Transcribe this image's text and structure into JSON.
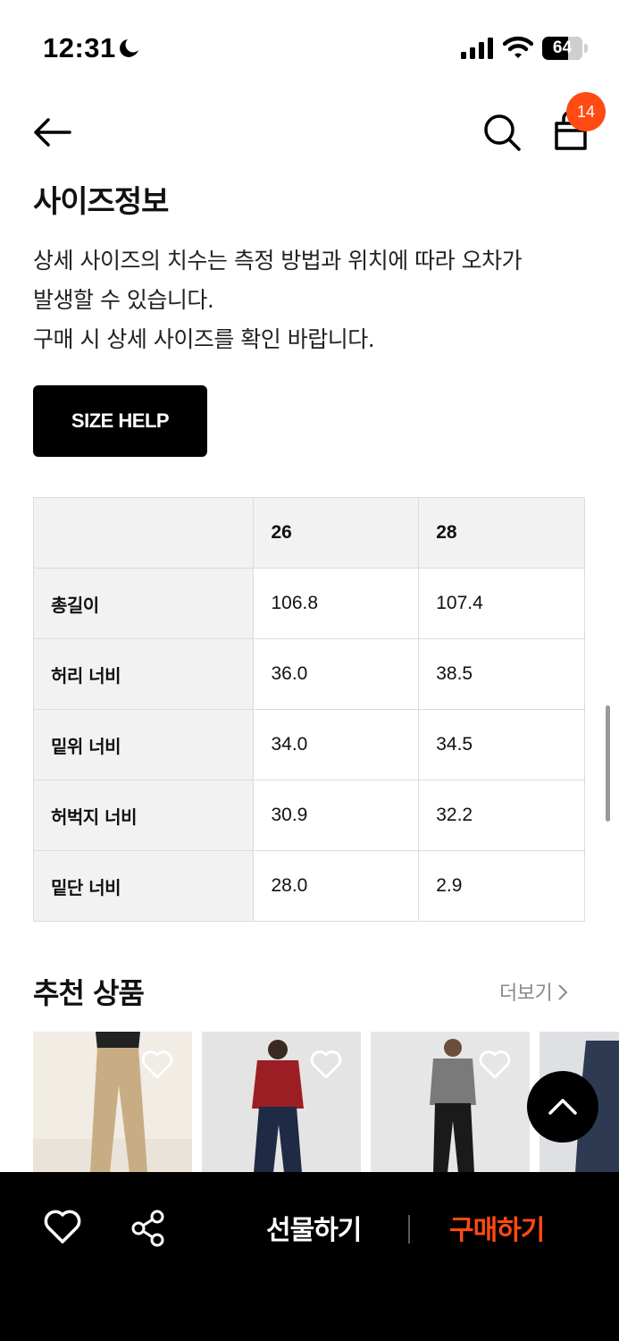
{
  "status_bar": {
    "time": "12:31",
    "battery": "64",
    "battery_level_percent": 64
  },
  "header": {
    "cart_count": "14"
  },
  "size_info": {
    "title": "사이즈정보",
    "description": [
      "상세 사이즈의 치수는 측정 방법과 위치에 따라 오차가",
      "발생할 수 있습니다.",
      "구매 시 상세 사이즈를 확인 바랍니다."
    ],
    "size_help_label": "SIZE HELP",
    "table": {
      "headers": [
        "",
        "26",
        "28"
      ],
      "rows": [
        {
          "label": "총길이",
          "values": [
            "106.8",
            "107.4"
          ]
        },
        {
          "label": "허리 너비",
          "values": [
            "36.0",
            "38.5"
          ]
        },
        {
          "label": "밑위 너비",
          "values": [
            "34.0",
            "34.5"
          ]
        },
        {
          "label": "허벅지 너비",
          "values": [
            "30.9",
            "32.2"
          ]
        },
        {
          "label": "밑단 너비",
          "values": [
            "28.0",
            "2.9"
          ]
        }
      ]
    }
  },
  "recommended": {
    "title": "추천 상품",
    "more_label": "더보기",
    "products": [
      {
        "name": "beige-wide-pants",
        "bg": "#e9e3da",
        "fg": "#c8ad84"
      },
      {
        "name": "red-knit-denim",
        "bg": "#e4e4e4",
        "fg": "#9c1e25"
      },
      {
        "name": "grey-knit-black-pants",
        "bg": "#e6e6e6",
        "fg": "#7a7a7a"
      },
      {
        "name": "dark-denim",
        "bg": "#dfe0e3",
        "fg": "#2e3a52"
      }
    ]
  },
  "bottom_bar": {
    "gift_label": "선물하기",
    "buy_label": "구매하기"
  },
  "colors": {
    "accent": "#ff4a12",
    "black": "#000000",
    "table_head": "#f2f2f2",
    "table_border": "#dcdcdc"
  },
  "icons": [
    "moon-icon",
    "signal-icon",
    "wifi-icon",
    "battery-icon",
    "back-arrow-icon",
    "search-icon",
    "shopping-bag-icon",
    "chevron-right-icon",
    "heart-icon",
    "chevron-up-icon",
    "share-icon"
  ]
}
